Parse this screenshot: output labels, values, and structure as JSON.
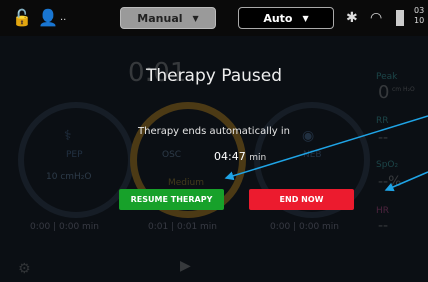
{
  "status_bar": {
    "unlock_icon": "unlock-icon",
    "user_icon": "user-icon",
    "user_dots": "..",
    "mode_manual": "Manual",
    "mode_auto": "Auto",
    "bluetooth_icon": "bluetooth-icon",
    "wifi_icon": "wifi-icon",
    "battery_icon": "battery-icon",
    "time_top": "03",
    "time_bottom": "10"
  },
  "background": {
    "timer": "0:01",
    "pep_label": "PEP",
    "pep_setting": "10 cmH₂O",
    "pep_time": "0:00 | 0:00 min",
    "osc_label": "OSC",
    "osc_setting": "Medium",
    "osc_time": "0:01 | 0:01 min",
    "neb_label": "NEB",
    "neb_time": "0:00 | 0:00 min",
    "peak_label": "Peak",
    "peak_value": "0",
    "peak_unit": "cm H₂O",
    "rr_label": "RR",
    "rr_value": "--",
    "spo2_label": "SpO₂",
    "spo2_value": "--%",
    "hr_label": "HR",
    "hr_value": "--"
  },
  "dialog": {
    "title": "Therapy Paused",
    "message": "Therapy ends automatically in",
    "countdown": "04:47",
    "countdown_unit": "min",
    "resume_label": "RESUME THERAPY",
    "end_label": "END NOW"
  },
  "colors": {
    "resume": "#17a12a",
    "end": "#ec1b2e",
    "osc_ring": "#c48a18",
    "annotation_arrow": "#1fa4e6"
  }
}
